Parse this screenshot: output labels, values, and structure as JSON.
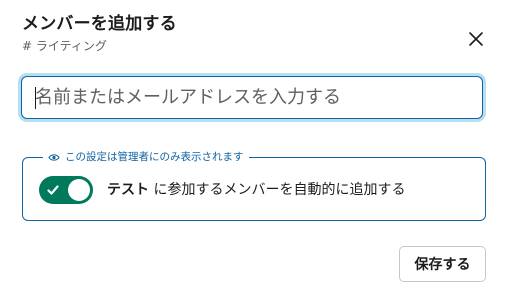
{
  "dialog": {
    "title": "メンバーを追加する",
    "subtitle": "# ライティング",
    "close_icon": "close-icon"
  },
  "search": {
    "placeholder": "名前またはメールアドレスを入力する",
    "value": ""
  },
  "admin_section": {
    "legend_icon": "eye-icon",
    "legend": "この設定は管理者にのみ表示されます",
    "toggle_on": true,
    "toggle_label_bold": "テスト",
    "toggle_label_rest": " に参加するメンバーを自動的に追加する"
  },
  "footer": {
    "save_label": "保存する"
  },
  "colors": {
    "accent": "#1264a3",
    "toggle_on": "#007a5a",
    "text": "#1d1c1d"
  }
}
